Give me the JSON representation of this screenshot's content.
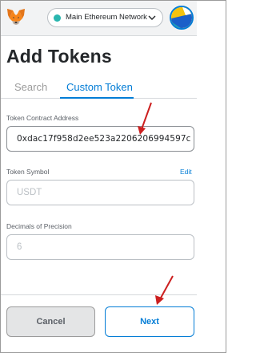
{
  "header": {
    "network_label": "Main Ethereum Network",
    "network_status_color": "#29b6af",
    "logo_icon": "metamask-fox-icon",
    "avatar_icon": "account-identicon"
  },
  "page_title": "Add Tokens",
  "tabs": [
    {
      "label": "Search",
      "active": false
    },
    {
      "label": "Custom Token",
      "active": true
    }
  ],
  "form": {
    "contract_address": {
      "label": "Token Contract Address",
      "value": "0xdac17f958d2ee523a2206206994597c"
    },
    "token_symbol": {
      "label": "Token Symbol",
      "edit_label": "Edit",
      "value": "USDT"
    },
    "decimals": {
      "label": "Decimals of Precision",
      "value": "6"
    }
  },
  "buttons": {
    "cancel": "Cancel",
    "next": "Next"
  },
  "annotations": {
    "arrow_color": "#cc1f1f",
    "arrow_icon": "red-pointer-arrow"
  },
  "colors": {
    "accent": "#037dd6",
    "header_bg": "#f2f3f4",
    "border": "#bbc0c5"
  }
}
